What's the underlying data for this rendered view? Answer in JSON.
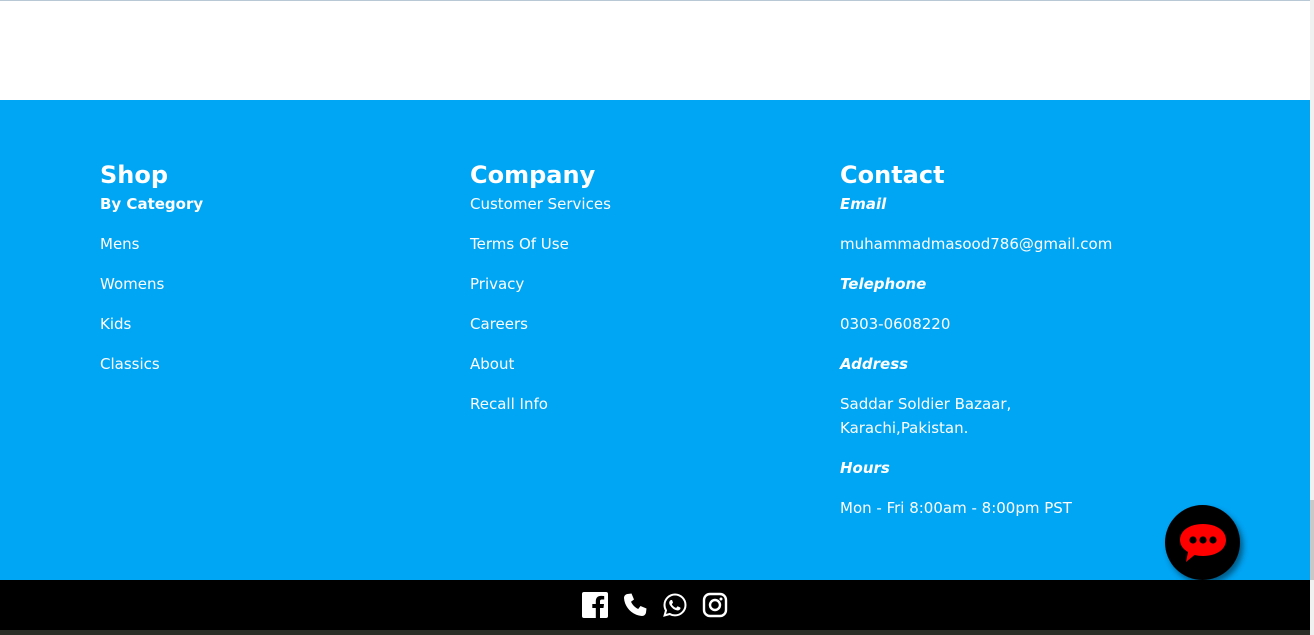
{
  "colors": {
    "footer_bg": "#00a5f4",
    "bottom_bar_bg": "#000000",
    "chat_bubble": "#ff0000"
  },
  "shop": {
    "title": "Shop",
    "subtitle": "By Category",
    "links": [
      "Mens",
      "Womens",
      "Kids",
      "Classics"
    ]
  },
  "company": {
    "title": "Company",
    "links": [
      "Customer Services",
      "Terms Of Use",
      "Privacy",
      "Careers",
      "About",
      "Recall Info"
    ]
  },
  "contact": {
    "title": "Contact",
    "email_label": "Email",
    "email": "muhammadmasood786@gmail.com",
    "telephone_label": "Telephone",
    "telephone": "0303-0608220",
    "address_label": "Address",
    "address": "Saddar Soldier Bazaar, Karachi,Pakistan.",
    "hours_label": "Hours",
    "hours": "Mon - Fri 8:00am - 8:00pm PST"
  },
  "social_icons": [
    "facebook-icon",
    "phone-icon",
    "whatsapp-icon",
    "instagram-icon"
  ],
  "chat_icon": "chat-bubble-icon"
}
